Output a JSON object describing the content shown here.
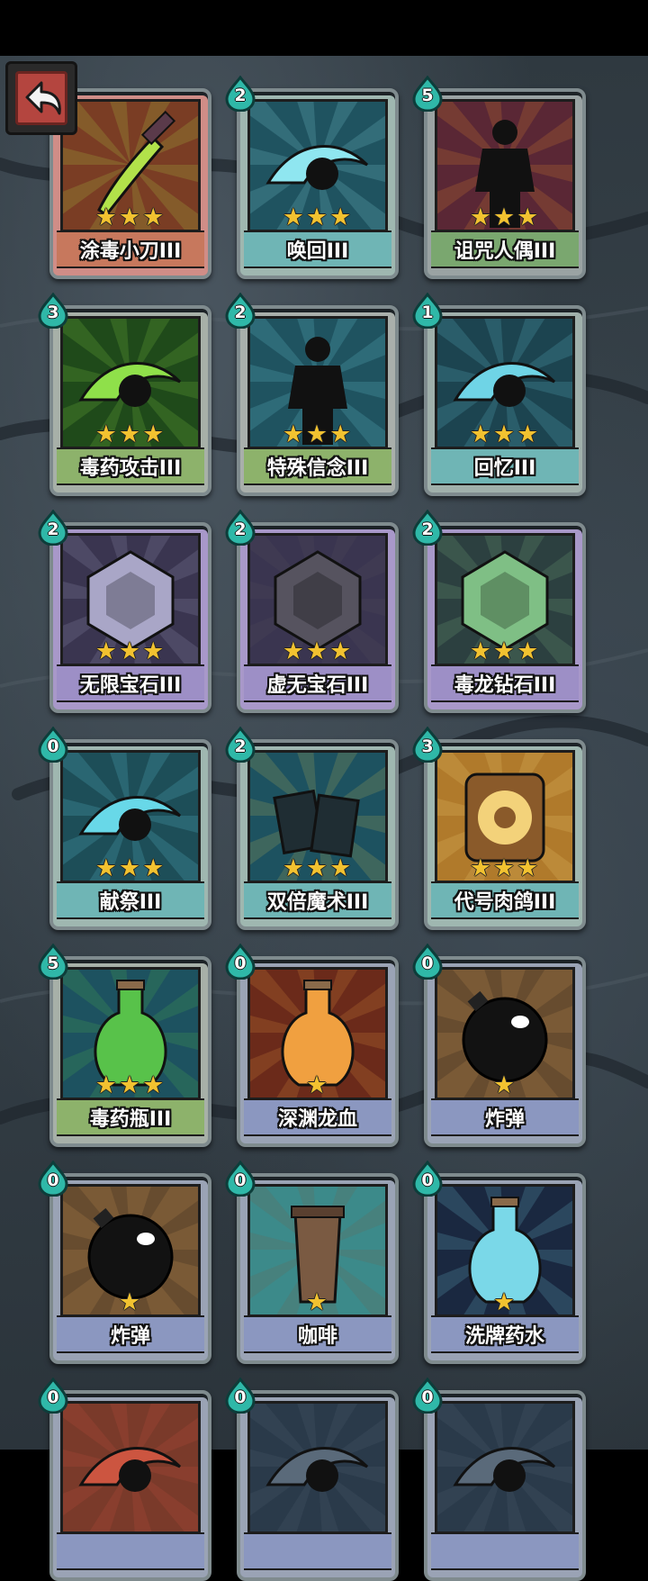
{
  "cards": [
    {
      "name": "涂毒小刀III",
      "cost": "",
      "stars": "★★★",
      "band": "#c7785d",
      "frame": "#d08d87",
      "art": "#7a3d24",
      "accent": "#b2e24a",
      "icon": "poison-dagger-icon"
    },
    {
      "name": "唤回III",
      "cost": "2",
      "stars": "★★★",
      "band": "#6fb5b5",
      "frame": "#9fb7b0",
      "art": "#1f5360",
      "accent": "#8fe6f0",
      "icon": "recall-hand-icon"
    },
    {
      "name": "诅咒人偶III",
      "cost": "5",
      "stars": "★★★",
      "band": "#7aa76f",
      "frame": "#9aa3a3",
      "art": "#5a2735",
      "accent": "#f29a2e",
      "icon": "cursed-doll-icon"
    },
    {
      "name": "毒药攻击III",
      "cost": "3",
      "stars": "★★★",
      "band": "#8db26b",
      "frame": "#a7b0a8",
      "art": "#1f4a1a",
      "accent": "#8fe04a",
      "icon": "poison-attack-icon"
    },
    {
      "name": "特殊信念III",
      "cost": "2",
      "stars": "★★★",
      "band": "#8db26b",
      "frame": "#a9afab",
      "art": "#1f5360",
      "accent": "#76d8e8",
      "icon": "special-belief-icon"
    },
    {
      "name": "回忆III",
      "cost": "1",
      "stars": "★★★",
      "band": "#6fb5b5",
      "frame": "#a0b0ab",
      "art": "#1c4450",
      "accent": "#6fd4e6",
      "icon": "memory-icon"
    },
    {
      "name": "无限宝石III",
      "cost": "2",
      "stars": "★★★",
      "band": "#9d8fc6",
      "frame": "#a898c9",
      "art": "#3a3550",
      "accent": "#a9a6c7",
      "icon": "infinity-gem-icon"
    },
    {
      "name": "虚无宝石III",
      "cost": "2",
      "stars": "★★★",
      "band": "#9d8fc6",
      "frame": "#a898c9",
      "art": "#3a3550",
      "accent": "#56535f",
      "icon": "void-gem-icon"
    },
    {
      "name": "毒龙钻石III",
      "cost": "2",
      "stars": "★★★",
      "band": "#9d8fc6",
      "frame": "#a898c9",
      "art": "#2c4040",
      "accent": "#7fbf85",
      "icon": "poison-dragon-diamond-icon"
    },
    {
      "name": "献祭III",
      "cost": "0",
      "stars": "★★★",
      "band": "#6fb5b5",
      "frame": "#9fb7b0",
      "art": "#1d4e58",
      "accent": "#68d8e8",
      "icon": "sacrifice-icon"
    },
    {
      "name": "双倍魔术III",
      "cost": "2",
      "stars": "★★★",
      "band": "#6fb5b5",
      "frame": "#9fb7b0",
      "art": "#1d5260",
      "accent": "#d9c054",
      "icon": "double-magic-icon"
    },
    {
      "name": "代号肉鸽III",
      "cost": "3",
      "stars": "★★★",
      "band": "#6fb5b5",
      "frame": "#9fb7b0",
      "art": "#b07a2b",
      "accent": "#f3d27a",
      "icon": "codename-roguelike-icon"
    },
    {
      "name": "毒药瓶III",
      "cost": "5",
      "stars": "★★★",
      "band": "#8db26b",
      "frame": "#a7b0a8",
      "art": "#1d5260",
      "accent": "#58c24a",
      "icon": "poison-bottle-icon"
    },
    {
      "name": "深渊龙血",
      "cost": "0",
      "stars": "★",
      "band": "#8b97c0",
      "frame": "#9aa3b5",
      "art": "#6b2a1a",
      "accent": "#f0a040",
      "icon": "abyss-dragon-blood-icon"
    },
    {
      "name": "炸弹",
      "cost": "0",
      "stars": "★",
      "band": "#8b97c0",
      "frame": "#9aa3b5",
      "art": "#7a5a36",
      "accent": "#121212",
      "icon": "bomb-icon"
    },
    {
      "name": "炸弹",
      "cost": "0",
      "stars": "★",
      "band": "#8b97c0",
      "frame": "#9aa3b5",
      "art": "#7a5a36",
      "accent": "#121212",
      "icon": "bomb-icon"
    },
    {
      "name": "咖啡",
      "cost": "0",
      "stars": "★",
      "band": "#8b97c0",
      "frame": "#9aa3b5",
      "art": "#3c8a8a",
      "accent": "#7a5a42",
      "icon": "coffee-icon"
    },
    {
      "name": "洗牌药水",
      "cost": "0",
      "stars": "★",
      "band": "#8b97c0",
      "frame": "#9aa3b5",
      "art": "#1a2840",
      "accent": "#7ad8e8",
      "icon": "shuffle-potion-icon"
    },
    {
      "name": "",
      "cost": "0",
      "stars": "",
      "band": "#8b97c0",
      "frame": "#9aa3b5",
      "art": "#7a3a2a",
      "accent": "#cc5540",
      "icon": "partial-card-icon"
    },
    {
      "name": "",
      "cost": "0",
      "stars": "",
      "band": "#8b97c0",
      "frame": "#9aa3b5",
      "art": "#2a3a4a",
      "accent": "#5a6a7a",
      "icon": "partial-card-icon"
    },
    {
      "name": "",
      "cost": "0",
      "stars": "",
      "band": "#8b97c0",
      "frame": "#9aa3b5",
      "art": "#2a3a4a",
      "accent": "#5a6a7a",
      "icon": "partial-card-icon"
    }
  ],
  "back_button": {
    "icon": "back-arrow-icon"
  },
  "colors": {
    "cost_drop": "#2fb8a8",
    "cost_rim": "#0d3d3a",
    "star": "#f2c230"
  }
}
